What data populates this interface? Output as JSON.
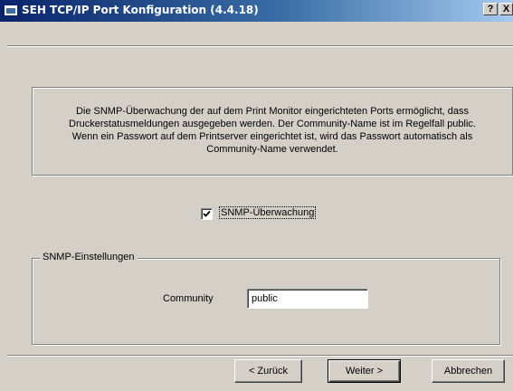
{
  "window": {
    "title": "SEH TCP/IP Port Konfiguration (4.4.18)",
    "help_label": "?",
    "close_label": "X"
  },
  "info": {
    "lines": [
      "Die SNMP-Überwachung der auf dem Print Monitor eingerichteten Ports ermöglicht, dass",
      "Druckerstatusmeldungen ausgegeben werden. Der Community-Name ist im Regelfall public.",
      "Wenn ein Passwort auf dem Printserver eingerichtet ist, wird das Passwort automatisch als",
      "Community-Name verwendet."
    ]
  },
  "snmp_monitoring": {
    "label": "SNMP-Überwachung",
    "checked": true
  },
  "settings_group": {
    "legend": "SNMP-Einstellungen",
    "community_label": "Community",
    "community_value": "public"
  },
  "buttons": {
    "back": "< Zurück",
    "next": "Weiter >",
    "cancel": "Abbrechen"
  }
}
